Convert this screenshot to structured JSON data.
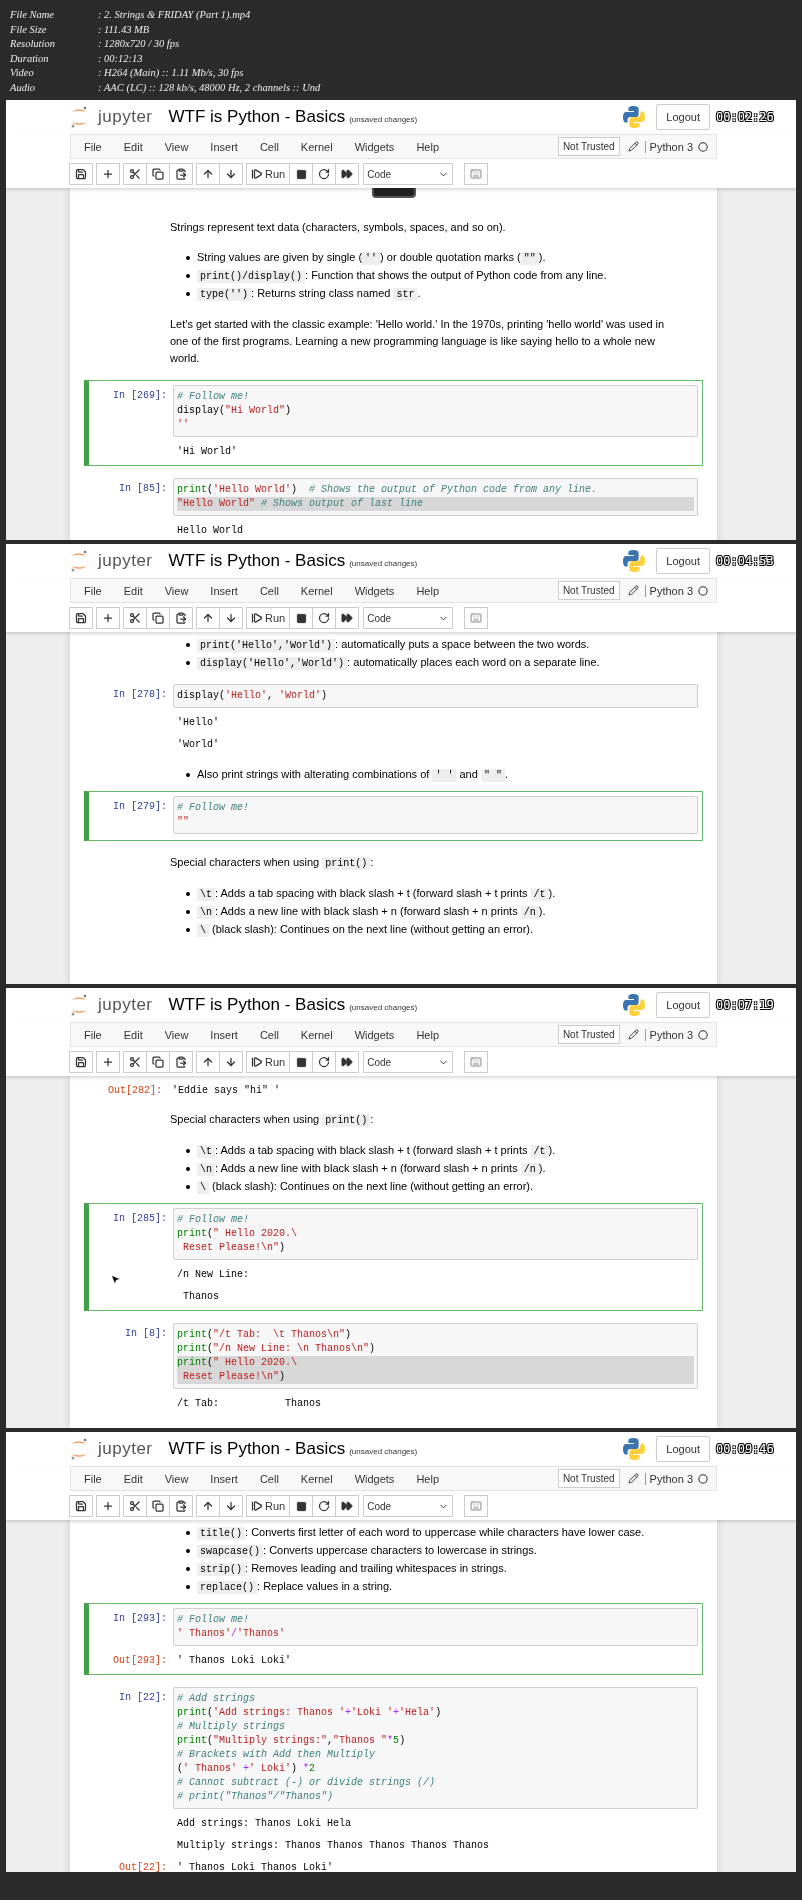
{
  "file_info": [
    {
      "label": "File Name",
      "value": ": 2. Strings & FRIDAY (Part 1).mp4"
    },
    {
      "label": "File Size",
      "value": ": 111.43 MB"
    },
    {
      "label": "Resolution",
      "value": ": 1280x720 / 30 fps"
    },
    {
      "label": "Duration",
      "value": ": 00:12:13"
    },
    {
      "label": "Video",
      "value": ": H264 (Main) :: 1.11 Mb/s, 30 fps"
    },
    {
      "label": "Audio",
      "value": ": AAC (LC) :: 128 kb/s, 48000 Hz, 2 channels :: Und"
    }
  ],
  "frames": [
    {
      "timestamp": "00:02:26",
      "logo_text": "jupyter",
      "notebook_title": "WTF is Python - Basics",
      "save_status": "(unsaved changes)",
      "logout": "Logout",
      "menu": [
        "File",
        "Edit",
        "View",
        "Insert",
        "Cell",
        "Kernel",
        "Widgets",
        "Help"
      ],
      "trust": "Not Trusted",
      "kernel": "Python 3",
      "run": "Run",
      "cell_type": "Code",
      "cells": [
        {
          "kind": "image"
        },
        {
          "kind": "paragraph",
          "segments": [
            {
              "t": "Strings represent text data (characters, symbols, spaces, and so on).",
              "kind": "text"
            }
          ]
        },
        {
          "kind": "bullets",
          "items": [
            {
              "segments": [
                {
                  "t": "String values are given by single (",
                  "kind": "text"
                },
                {
                  "t": "''",
                  "kind": "code"
                },
                {
                  "t": ") or double quotation marks (",
                  "kind": "text"
                },
                {
                  "t": "\"\"",
                  "kind": "code"
                },
                {
                  "t": ").",
                  "kind": "text"
                }
              ]
            },
            {
              "segments": [
                {
                  "t": "print()/display()",
                  "kind": "code"
                },
                {
                  "t": ": Function that shows the output of Python code from any line.",
                  "kind": "text"
                }
              ]
            },
            {
              "segments": [
                {
                  "t": "type('')",
                  "kind": "code"
                },
                {
                  "t": ": Returns string class named ",
                  "kind": "text"
                },
                {
                  "t": "str",
                  "kind": "code"
                },
                {
                  "t": ".",
                  "kind": "text"
                }
              ]
            }
          ]
        },
        {
          "kind": "paragraph",
          "segments": [
            {
              "t": "Let's get started with the classic example: 'Hello world.' In the 1970s, printing 'hello world' was used in one of the first programs. Learning a new programming language is like saying hello to a whole new world.",
              "kind": "text"
            }
          ]
        },
        {
          "kind": "code",
          "prompt": "In [269]:",
          "selected": true,
          "lines": [
            {
              "highlighted": false,
              "tokens": [
                {
                  "t": "# Follow me!",
                  "kind": "comment"
                }
              ]
            },
            {
              "highlighted": false,
              "tokens": [
                {
                  "t": "display(",
                  "kind": "plain"
                },
                {
                  "t": "\"Hi World\"",
                  "kind": "string"
                },
                {
                  "t": ")",
                  "kind": "plain"
                }
              ]
            },
            {
              "highlighted": false,
              "tokens": [
                {
                  "t": "''",
                  "kind": "string"
                }
              ]
            }
          ],
          "outputs": [
            {
              "text": "'Hi World'"
            }
          ]
        },
        {
          "kind": "code",
          "prompt": "In [85]:",
          "selected": false,
          "lines": [
            {
              "highlighted": false,
              "tokens": [
                {
                  "t": "print",
                  "kind": "builtin"
                },
                {
                  "t": "(",
                  "kind": "plain"
                },
                {
                  "t": "'Hello World'",
                  "kind": "string"
                },
                {
                  "t": ")  ",
                  "kind": "plain"
                },
                {
                  "t": "# Shows the output of Python code from any line.",
                  "kind": "comment"
                }
              ]
            },
            {
              "highlighted": true,
              "tokens": [
                {
                  "t": "\"Hello World\"",
                  "kind": "string"
                },
                {
                  "t": " # Shows output of last line",
                  "kind": "comment"
                }
              ]
            }
          ],
          "outputs": [
            {
              "text": "Hello World"
            }
          ]
        }
      ]
    },
    {
      "timestamp": "00:04:53",
      "logo_text": "jupyter",
      "notebook_title": "WTF is Python - Basics",
      "save_status": "(unsaved changes)",
      "logout": "Logout",
      "menu": [
        "File",
        "Edit",
        "View",
        "Insert",
        "Cell",
        "Kernel",
        "Widgets",
        "Help"
      ],
      "trust": "Not Trusted",
      "kernel": "Python 3",
      "run": "Run",
      "cell_type": "Code",
      "cells": [
        {
          "kind": "bullets",
          "items": [
            {
              "segments": [
                {
                  "t": "print('Hello','World')",
                  "kind": "code"
                },
                {
                  "t": ": automatically puts a space between the two words.",
                  "kind": "text"
                }
              ]
            },
            {
              "segments": [
                {
                  "t": "display('Hello','World')",
                  "kind": "code"
                },
                {
                  "t": ": automatically places each word on a separate line.",
                  "kind": "text"
                }
              ]
            }
          ]
        },
        {
          "kind": "code",
          "prompt": "In [278]:",
          "selected": false,
          "lines": [
            {
              "highlighted": false,
              "tokens": [
                {
                  "t": "display(",
                  "kind": "plain"
                },
                {
                  "t": "'Hello'",
                  "kind": "string"
                },
                {
                  "t": ", ",
                  "kind": "plain"
                },
                {
                  "t": "'World'",
                  "kind": "string"
                },
                {
                  "t": ")",
                  "kind": "plain"
                }
              ]
            }
          ],
          "outputs": [
            {
              "text": "'Hello'"
            },
            {
              "text": "'World'"
            }
          ]
        },
        {
          "kind": "bullets",
          "items": [
            {
              "segments": [
                {
                  "t": "Also print strings with alterating combinations of ",
                  "kind": "text"
                },
                {
                  "t": "' '",
                  "kind": "code"
                },
                {
                  "t": " and ",
                  "kind": "text"
                },
                {
                  "t": "\" \"",
                  "kind": "code"
                },
                {
                  "t": ".",
                  "kind": "text"
                }
              ]
            }
          ]
        },
        {
          "kind": "code",
          "prompt": "In [279]:",
          "selected": true,
          "lines": [
            {
              "highlighted": false,
              "tokens": [
                {
                  "t": "# Follow me!",
                  "kind": "comment"
                }
              ]
            },
            {
              "highlighted": false,
              "tokens": [
                {
                  "t": "\"\"",
                  "kind": "string"
                }
              ]
            }
          ]
        },
        {
          "kind": "paragraph",
          "segments": [
            {
              "t": "Special characters when using ",
              "kind": "text"
            },
            {
              "t": "print()",
              "kind": "code"
            },
            {
              "t": ":",
              "kind": "text"
            }
          ]
        },
        {
          "kind": "bullets",
          "items": [
            {
              "segments": [
                {
                  "t": "\\t",
                  "kind": "code"
                },
                {
                  "t": ": Adds a tab spacing with black slash + t (forward slash + t prints ",
                  "kind": "text"
                },
                {
                  "t": "/t",
                  "kind": "code"
                },
                {
                  "t": ").",
                  "kind": "text"
                }
              ]
            },
            {
              "segments": [
                {
                  "t": "\\n",
                  "kind": "code"
                },
                {
                  "t": ": Adds a new line with black slash + n (forward slash + n prints ",
                  "kind": "text"
                },
                {
                  "t": "/n",
                  "kind": "code"
                },
                {
                  "t": ").",
                  "kind": "text"
                }
              ]
            },
            {
              "segments": [
                {
                  "t": "\\",
                  "kind": "code"
                },
                {
                  "t": " (black slash): Continues on the next line (without getting an error).",
                  "kind": "text"
                }
              ]
            }
          ]
        }
      ]
    },
    {
      "timestamp": "00:07:19",
      "logo_text": "jupyter",
      "notebook_title": "WTF is Python - Basics",
      "save_status": "(unsaved changes)",
      "logout": "Logout",
      "menu": [
        "File",
        "Edit",
        "View",
        "Insert",
        "Cell",
        "Kernel",
        "Widgets",
        "Help"
      ],
      "trust": "Not Trusted",
      "kernel": "Python 3",
      "run": "Run",
      "cell_type": "Code",
      "pointer_visible": true,
      "cells": [
        {
          "kind": "output",
          "prompt": "Out[282]:",
          "text": "'Eddie says \"hi\" '"
        },
        {
          "kind": "paragraph",
          "segments": [
            {
              "t": "Special characters when using ",
              "kind": "text"
            },
            {
              "t": "print()",
              "kind": "code"
            },
            {
              "t": ":",
              "kind": "text"
            }
          ]
        },
        {
          "kind": "bullets",
          "items": [
            {
              "segments": [
                {
                  "t": "\\t",
                  "kind": "code"
                },
                {
                  "t": ": Adds a tab spacing with black slash + t (forward slash + t prints ",
                  "kind": "text"
                },
                {
                  "t": "/t",
                  "kind": "code"
                },
                {
                  "t": ").",
                  "kind": "text"
                }
              ]
            },
            {
              "segments": [
                {
                  "t": "\\n",
                  "kind": "code"
                },
                {
                  "t": ": Adds a new line with black slash + n (forward slash + n prints ",
                  "kind": "text"
                },
                {
                  "t": "/n",
                  "kind": "code"
                },
                {
                  "t": ").",
                  "kind": "text"
                }
              ]
            },
            {
              "segments": [
                {
                  "t": "\\",
                  "kind": "code"
                },
                {
                  "t": " (black slash): Continues on the next line (without getting an error).",
                  "kind": "text"
                }
              ]
            }
          ]
        },
        {
          "kind": "code",
          "prompt": "In [285]:",
          "selected": true,
          "lines": [
            {
              "highlighted": false,
              "tokens": [
                {
                  "t": "# Follow me!",
                  "kind": "comment"
                }
              ]
            },
            {
              "highlighted": false,
              "tokens": [
                {
                  "t": "print",
                  "kind": "builtin"
                },
                {
                  "t": "(",
                  "kind": "plain"
                },
                {
                  "t": "\" Hello 2020.\\",
                  "kind": "string"
                }
              ]
            },
            {
              "highlighted": false,
              "tokens": [
                {
                  "t": " Reset Please!\\n\"",
                  "kind": "string"
                },
                {
                  "t": ")",
                  "kind": "plain"
                }
              ]
            }
          ],
          "outputs": [
            {
              "text": "/n New Line:"
            },
            {
              "text": " Thanos"
            }
          ]
        },
        {
          "kind": "code",
          "prompt": "In [8]:",
          "selected": false,
          "lines": [
            {
              "highlighted": false,
              "tokens": [
                {
                  "t": "print",
                  "kind": "builtin"
                },
                {
                  "t": "(",
                  "kind": "plain"
                },
                {
                  "t": "\"/t Tab:  \\t Thanos\\n\"",
                  "kind": "string"
                },
                {
                  "t": ")",
                  "kind": "plain"
                }
              ]
            },
            {
              "highlighted": false,
              "tokens": [
                {
                  "t": "print",
                  "kind": "builtin"
                },
                {
                  "t": "(",
                  "kind": "plain"
                },
                {
                  "t": "\"/n New Line: \\n Thanos\\n\"",
                  "kind": "string"
                },
                {
                  "t": ")",
                  "kind": "plain"
                }
              ]
            },
            {
              "highlighted": true,
              "tokens": [
                {
                  "t": "print",
                  "kind": "builtin"
                },
                {
                  "t": "(",
                  "kind": "plain"
                },
                {
                  "t": "\" Hello 2020.\\",
                  "kind": "string"
                }
              ]
            },
            {
              "highlighted": true,
              "tokens": [
                {
                  "t": " Reset Please!\\n\"",
                  "kind": "string"
                },
                {
                  "t": ")",
                  "kind": "plain"
                }
              ]
            }
          ],
          "outputs": [
            {
              "text": "/t Tab:           Thanos"
            }
          ]
        }
      ]
    },
    {
      "timestamp": "00:09:46",
      "logo_text": "jupyter",
      "notebook_title": "WTF is Python - Basics",
      "save_status": "(unsaved changes)",
      "logout": "Logout",
      "menu": [
        "File",
        "Edit",
        "View",
        "Insert",
        "Cell",
        "Kernel",
        "Widgets",
        "Help"
      ],
      "trust": "Not Trusted",
      "kernel": "Python 3",
      "run": "Run",
      "cell_type": "Code",
      "cells": [
        {
          "kind": "bullets",
          "items": [
            {
              "segments": [
                {
                  "t": "title()",
                  "kind": "code"
                },
                {
                  "t": ": Converts first letter of each word to uppercase while characters have lower case.",
                  "kind": "text"
                }
              ]
            },
            {
              "segments": [
                {
                  "t": "swapcase()",
                  "kind": "code"
                },
                {
                  "t": ": Converts uppercase characters to lowercase in strings.",
                  "kind": "text"
                }
              ]
            },
            {
              "segments": [
                {
                  "t": "strip()",
                  "kind": "code"
                },
                {
                  "t": ": Removes leading and trailing whitespaces in strings.",
                  "kind": "text"
                }
              ]
            },
            {
              "segments": [
                {
                  "t": "replace()",
                  "kind": "code"
                },
                {
                  "t": ": Replace values in a string.",
                  "kind": "text"
                }
              ]
            }
          ]
        },
        {
          "kind": "code",
          "prompt": "In [293]:",
          "selected": true,
          "lines": [
            {
              "highlighted": false,
              "tokens": [
                {
                  "t": "# Follow me!",
                  "kind": "comment"
                }
              ]
            },
            {
              "highlighted": false,
              "tokens": [
                {
                  "t": "' Thanos'",
                  "kind": "string"
                },
                {
                  "t": "/",
                  "kind": "operator"
                },
                {
                  "t": "'Thanos'",
                  "kind": "string"
                }
              ]
            }
          ],
          "outputs": [
            {
              "prompt": "Out[293]:",
              "text": "' Thanos Loki Loki'"
            }
          ]
        },
        {
          "kind": "code",
          "prompt": "In [22]:",
          "selected": false,
          "lines": [
            {
              "highlighted": false,
              "tokens": [
                {
                  "t": "# Add strings",
                  "kind": "comment"
                }
              ]
            },
            {
              "highlighted": false,
              "tokens": [
                {
                  "t": "print",
                  "kind": "builtin"
                },
                {
                  "t": "(",
                  "kind": "plain"
                },
                {
                  "t": "'Add strings: Thanos '",
                  "kind": "string"
                },
                {
                  "t": "+",
                  "kind": "operator"
                },
                {
                  "t": "'Loki '",
                  "kind": "string"
                },
                {
                  "t": "+",
                  "kind": "operator"
                },
                {
                  "t": "'Hela'",
                  "kind": "string"
                },
                {
                  "t": ")",
                  "kind": "plain"
                }
              ]
            },
            {
              "highlighted": false,
              "tokens": [
                {
                  "t": "# Multiply strings",
                  "kind": "comment"
                }
              ]
            },
            {
              "highlighted": false,
              "tokens": [
                {
                  "t": "print",
                  "kind": "builtin"
                },
                {
                  "t": "(",
                  "kind": "plain"
                },
                {
                  "t": "\"Multiply strings:\"",
                  "kind": "string"
                },
                {
                  "t": ",",
                  "kind": "plain"
                },
                {
                  "t": "\"Thanos \"",
                  "kind": "string"
                },
                {
                  "t": "*",
                  "kind": "operator"
                },
                {
                  "t": "5",
                  "kind": "number"
                },
                {
                  "t": ")",
                  "kind": "plain"
                }
              ]
            },
            {
              "highlighted": false,
              "tokens": [
                {
                  "t": "# Brackets with Add then Multiply",
                  "kind": "comment"
                }
              ]
            },
            {
              "highlighted": false,
              "tokens": [
                {
                  "t": "(",
                  "kind": "plain"
                },
                {
                  "t": "' Thanos'",
                  "kind": "string"
                },
                {
                  "t": " +",
                  "kind": "operator"
                },
                {
                  "t": "' Loki'",
                  "kind": "string"
                },
                {
                  "t": ") ",
                  "kind": "plain"
                },
                {
                  "t": "*",
                  "kind": "operator"
                },
                {
                  "t": "2",
                  "kind": "number"
                }
              ]
            },
            {
              "highlighted": false,
              "tokens": [
                {
                  "t": "# Cannot subtract (-) or divide strings (/)",
                  "kind": "comment"
                }
              ]
            },
            {
              "highlighted": false,
              "tokens": [
                {
                  "t": "# print(\"Thanos\"/\"Thanos\")",
                  "kind": "comment"
                }
              ]
            }
          ],
          "outputs": [
            {
              "text": "Add strings: Thanos Loki Hela"
            },
            {
              "text": "Multiply strings: Thanos Thanos Thanos Thanos Thanos"
            },
            {
              "prompt": "Out[22]:",
              "text": "' Thanos Loki Thanos Loki'"
            }
          ]
        }
      ]
    }
  ]
}
